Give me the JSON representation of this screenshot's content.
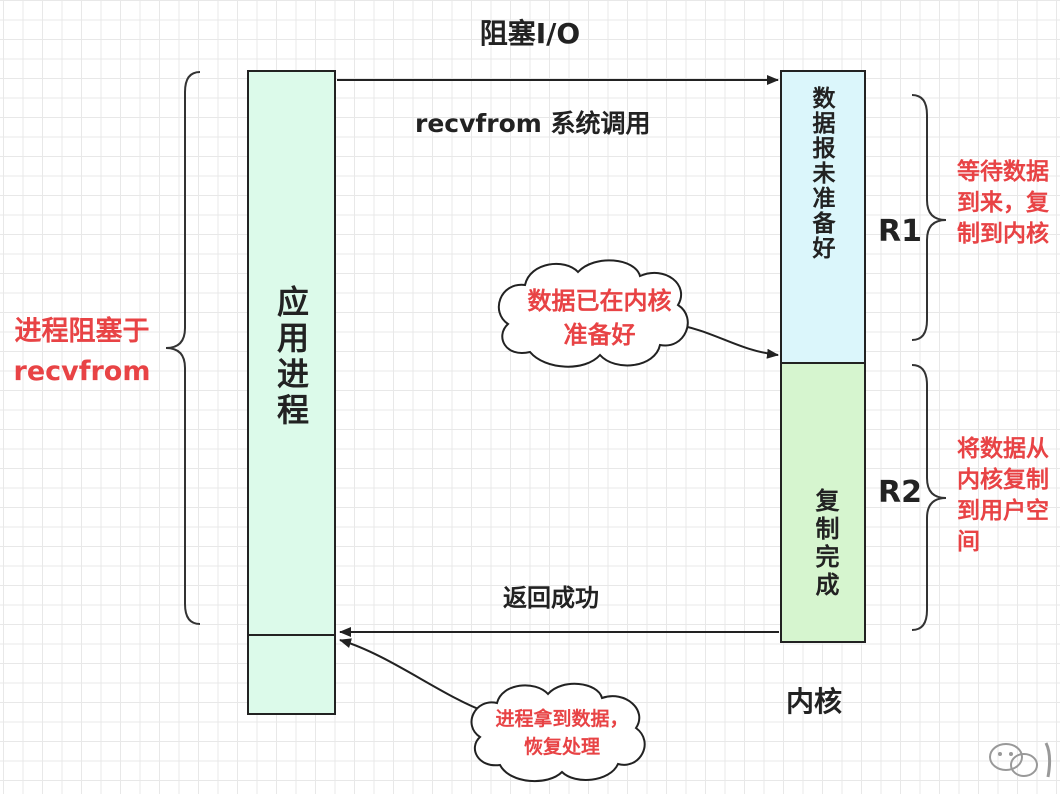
{
  "title": "阻塞I/O",
  "app_process": {
    "label": "应用进程"
  },
  "left_label": {
    "line1": "进程阻塞于",
    "line2": "recvfrom"
  },
  "syscall_label": "recvfrom 系统调用",
  "return_label": "返回成功",
  "kernel": {
    "label": "内核",
    "r1_box_label": "数据报未准备好",
    "r2_box_label": "复制完成"
  },
  "phases": {
    "r1": {
      "label": "R1",
      "note": "等待数据到来，复制到内核"
    },
    "r2": {
      "label": "R2",
      "note": "将数据从内核复制到用户空间"
    }
  },
  "callouts": {
    "data_ready": "数据已在内核准备好",
    "process_resumes": "进程拿到数据，恢复处理"
  },
  "colors": {
    "app_fill": "#dcfaea",
    "r1_fill": "#dbf6fb",
    "r2_fill": "#d6f5cf",
    "note_red": "#e84345"
  }
}
